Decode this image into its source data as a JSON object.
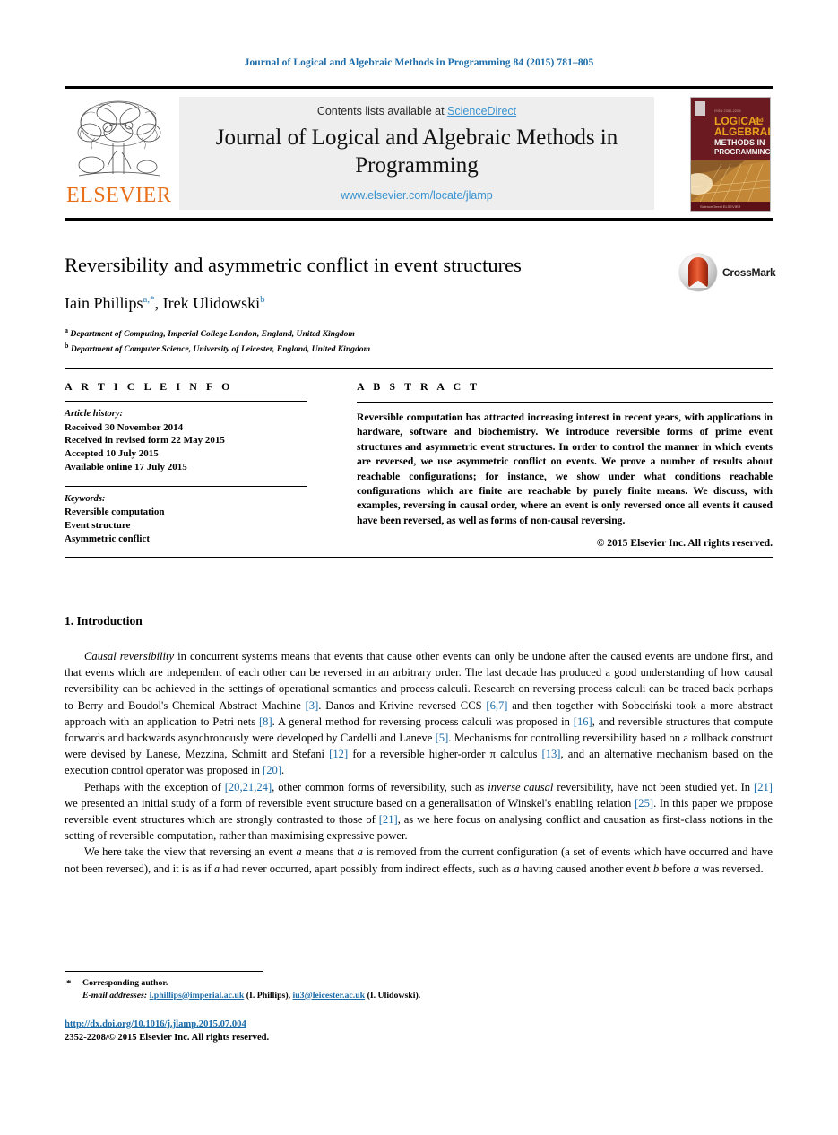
{
  "running_head": "Journal of Logical and Algebraic Methods in Programming 84 (2015) 781–805",
  "masthead": {
    "contents_prefix": "Contents lists available at ",
    "sciencedirect": "ScienceDirect",
    "journal_title": "Journal of Logical and Algebraic Methods in Programming",
    "journal_url": "www.elsevier.com/locate/jlamp",
    "publisher_name": "ELSEVIER",
    "publisher_logo_icon": "elsevier-tree-icon",
    "cover_icon": "journal-cover-thumbnail",
    "cover_title_lines": [
      "LOGICAL and",
      "ALGEBRAIC",
      "METHODS IN",
      "PROGRAMMING"
    ],
    "link_color": "#3a93d0",
    "band_color": "#eeeeee",
    "elsevier_orange": "#e8701a"
  },
  "article": {
    "title": "Reversibility and asymmetric conflict in event structures",
    "authors_html": "Iain Phillips <sup class=\"aff-mark\">a,*</sup>, Irek Ulidowski <sup class=\"aff-mark\">b</sup>",
    "authors_plain": "Iain Phillips a,*, Irek Ulidowski b",
    "affiliations": [
      {
        "marker": "a",
        "text": "Department of Computing, Imperial College London, England, United Kingdom"
      },
      {
        "marker": "b",
        "text": "Department of Computer Science, University of Leicester, England, United Kingdom"
      }
    ],
    "crossmark_label": "CrossMark",
    "crossmark_icon": "crossmark-badge-icon"
  },
  "article_info": {
    "heading": "A R T I C L E   I N F O",
    "history_label": "Article history:",
    "history": [
      "Received 30 November 2014",
      "Received in revised form 22 May 2015",
      "Accepted 10 July 2015",
      "Available online 17 July 2015"
    ],
    "keywords_label": "Keywords:",
    "keywords": [
      "Reversible computation",
      "Event structure",
      "Asymmetric conflict"
    ]
  },
  "abstract": {
    "heading": "A B S T R A C T",
    "text": "Reversible computation has attracted increasing interest in recent years, with applications in hardware, software and biochemistry. We introduce reversible forms of prime event structures and asymmetric event structures. In order to control the manner in which events are reversed, we use asymmetric conflict on events. We prove a number of results about reachable configurations; for instance, we show under what conditions reachable configurations which are finite are reachable by purely finite means. We discuss, with examples, reversing in causal order, where an event is only reversed once all events it caused have been reversed, as well as forms of non-causal reversing.",
    "copyright": "© 2015 Elsevier Inc. All rights reserved."
  },
  "body": {
    "section_number_title": "1.  Introduction",
    "paragraphs": [
      {
        "id": "p1",
        "html": "<span class=\"ital\">Causal reversibility</span> in concurrent systems means that events that cause other events can only be undone after the caused events are undone first, and that events which are independent of each other can be reversed in an arbitrary order. The last decade has produced a good understanding of how causal reversibility can be achieved in the settings of operational semantics and process calculi. Research on reversing process calculi can be traced back perhaps to Berry and Boudol's Chemical Abstract Machine <span class=\"ref\">[3]</span>. Danos and Krivine reversed CCS <span class=\"ref\">[6,7]</span> and then together with Sobociński took a more abstract approach with an application to Petri nets <span class=\"ref\">[8]</span>. A general method for reversing process calculi was proposed in <span class=\"ref\">[16]</span>, and reversible structures that compute forwards and backwards asynchronously were developed by Cardelli and Laneve <span class=\"ref\">[5]</span>. Mechanisms for controlling reversibility based on a rollback construct were devised by Lanese, Mezzina, Schmitt and Stefani <span class=\"ref\">[12]</span> for a reversible higher-order π calculus <span class=\"ref\">[13]</span>, and an alternative mechanism based on the execution control operator was proposed in <span class=\"ref\">[20]</span>."
      },
      {
        "id": "p2",
        "html": "Perhaps with the exception of <span class=\"ref\">[20,21,24]</span>, other common forms of reversibility, such as <span class=\"ital\">inverse causal</span> reversibility, have not been studied yet. In <span class=\"ref\">[21]</span> we presented an initial study of a form of reversible event structure based on a generalisation of Winskel's enabling relation <span class=\"ref\">[25]</span>. In this paper we propose reversible event structures which are strongly contrasted to those of <span class=\"ref\">[21]</span>, as we here focus on analysing conflict and causation as first-class notions in the setting of reversible computation, rather than maximising expressive power."
      },
      {
        "id": "p3",
        "html": "We here take the view that reversing an event <span class=\"ital\">a</span> means that <span class=\"ital\">a</span> is removed from the current configuration (a set of events which have occurred and have not been reversed), and it is as if <span class=\"ital\">a</span> had never occurred, apart possibly from indirect effects, such as <span class=\"ital\">a</span> having caused another event <span class=\"ital\">b</span> before <span class=\"ital\">a</span> was reversed."
      }
    ]
  },
  "footer": {
    "corresponding_author": "Corresponding author.",
    "email_label": "E-mail addresses:",
    "emails": [
      {
        "address": "i.phillips@imperial.ac.uk",
        "owner": "(I. Phillips)"
      },
      {
        "address": "iu3@leicester.ac.uk",
        "owner": "(I. Ulidowski)"
      }
    ],
    "doi": "http://dx.doi.org/10.1016/j.jlamp.2015.07.004",
    "issn_line": "2352-2208/© 2015 Elsevier Inc. All rights reserved."
  }
}
